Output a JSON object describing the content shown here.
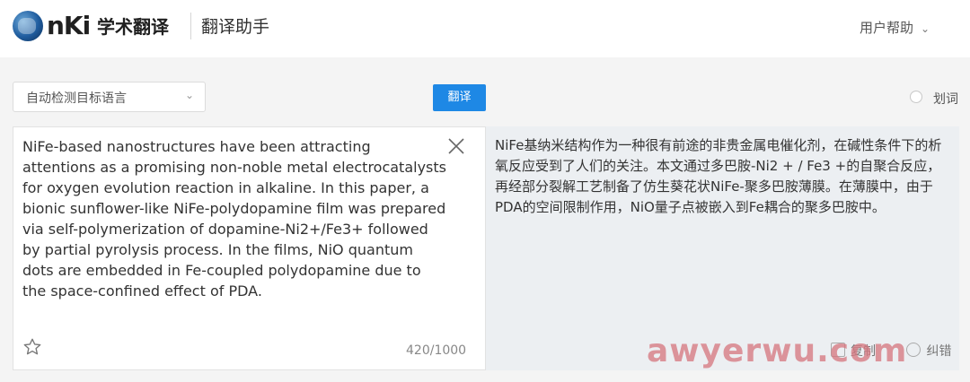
{
  "header": {
    "logo_text": "nKi",
    "logo_cn": "学术翻译",
    "subtitle": "翻译助手",
    "help_label": "用户帮助"
  },
  "toolbar": {
    "target_lang_value": "自动检测目标语言",
    "translate_label": "翻译",
    "word_select_label": "划词"
  },
  "source": {
    "text": "NiFe-based nanostructures have been attracting attentions as a promising non-noble metal electrocatalysts for oxygen evolution reaction in alkaline. In this paper, a bionic sunflower-like NiFe-polydopamine film was prepared via self-polymerization of dopamine-Ni2+/Fe3+ followed by partial pyrolysis process. In the films, NiO quantum dots are embedded in Fe-coupled polydopamine due to the space-confined effect of PDA.",
    "char_count": "420/1000"
  },
  "target": {
    "text": "NiFe基纳米结构作为一种很有前途的非贵金属电催化剂，在碱性条件下的析氧反应受到了人们的关注。本文通过多巴胺-Ni2 + / Fe3 +的自聚合反应，再经部分裂解工艺制备了仿生葵花状NiFe-聚多巴胺薄膜。在薄膜中，由于PDA的空间限制作用，NiO量子点被嵌入到Fe耦合的聚多巴胺中。",
    "copy_label": "复制",
    "correct_label": "纠错"
  },
  "watermark": "awyerwu.com",
  "colors": {
    "accent": "#1e88e5",
    "target_bg": "#eceff2",
    "page_bg": "#f4f4f4"
  }
}
